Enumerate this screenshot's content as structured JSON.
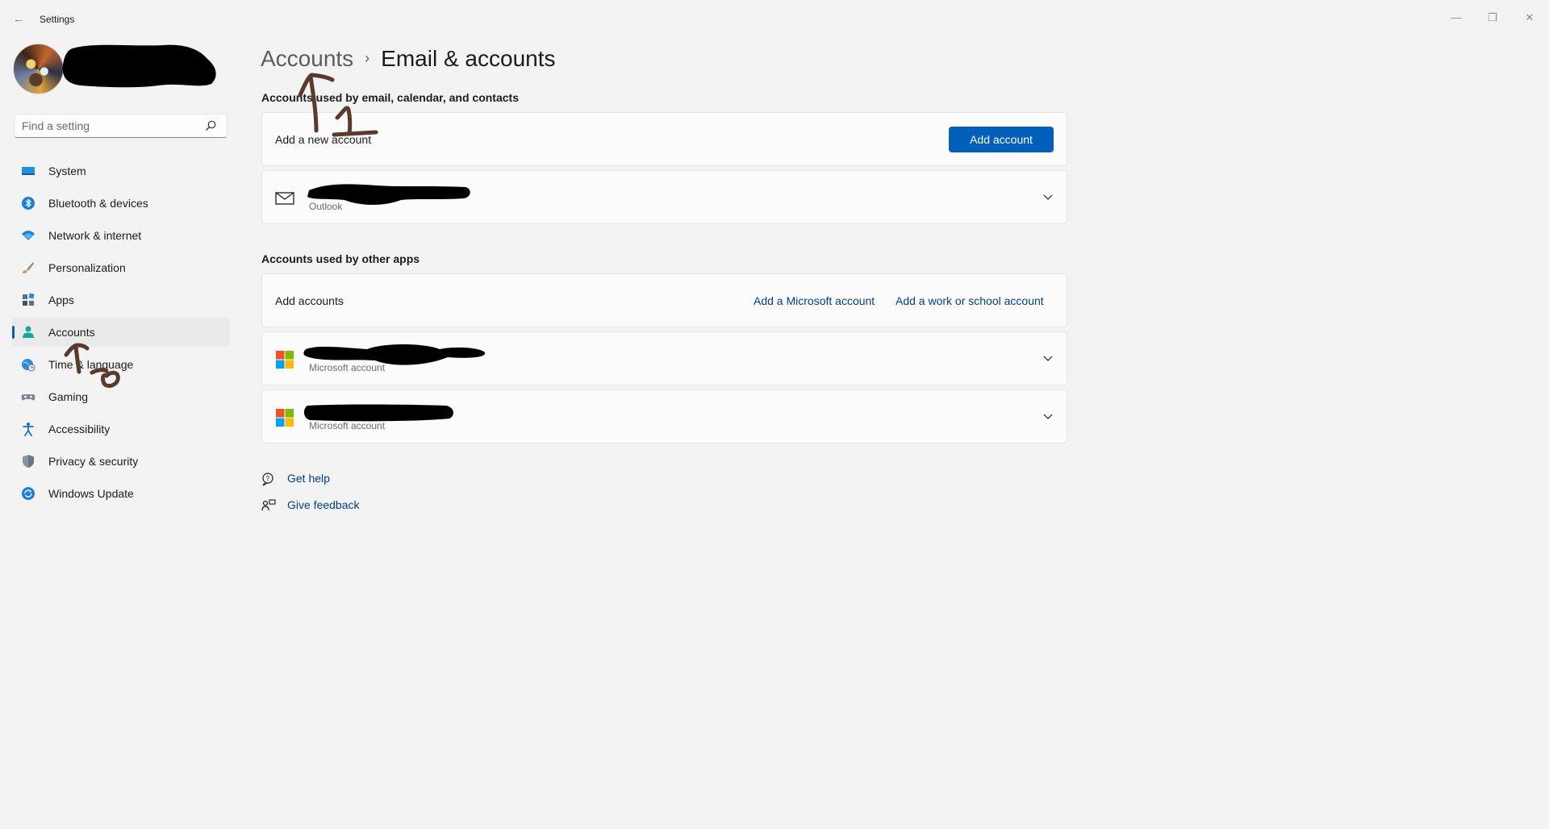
{
  "window": {
    "title": "Settings",
    "back_glyph": "←",
    "minimize_glyph": "—",
    "maximize_glyph": "❐",
    "close_glyph": "✕"
  },
  "search": {
    "placeholder": "Find a setting",
    "icon": "search-icon"
  },
  "sidebar": {
    "items": [
      {
        "label": "System",
        "icon": "system-icon"
      },
      {
        "label": "Bluetooth & devices",
        "icon": "bluetooth-icon"
      },
      {
        "label": "Network & internet",
        "icon": "wifi-icon"
      },
      {
        "label": "Personalization",
        "icon": "brush-icon"
      },
      {
        "label": "Apps",
        "icon": "apps-icon"
      },
      {
        "label": "Accounts",
        "icon": "person-icon",
        "selected": true
      },
      {
        "label": "Time & language",
        "icon": "globe-clock-icon"
      },
      {
        "label": "Gaming",
        "icon": "gamepad-icon"
      },
      {
        "label": "Accessibility",
        "icon": "accessibility-icon"
      },
      {
        "label": "Privacy & security",
        "icon": "shield-icon"
      },
      {
        "label": "Windows Update",
        "icon": "update-icon"
      }
    ]
  },
  "breadcrumb": {
    "parent": "Accounts",
    "separator": "›",
    "current": "Email & accounts"
  },
  "email_section": {
    "title": "Accounts used by email, calendar, and contacts",
    "add_row_label": "Add a new account",
    "add_button": "Add account",
    "accounts": [
      {
        "type": "Outlook",
        "icon": "mail-icon"
      }
    ]
  },
  "apps_section": {
    "title": "Accounts used by other apps",
    "add_row_label": "Add accounts",
    "add_microsoft_link": "Add a Microsoft account",
    "add_work_link": "Add a work or school account",
    "accounts": [
      {
        "type": "Microsoft account",
        "icon": "microsoft-logo-icon"
      },
      {
        "type": "Microsoft account",
        "icon": "microsoft-logo-icon"
      }
    ]
  },
  "footer": {
    "help": "Get help",
    "feedback": "Give feedback"
  },
  "colors": {
    "accent": "#005fb8",
    "link": "#003e92",
    "annotation": "#5a3a2c",
    "redaction": "#000000"
  }
}
